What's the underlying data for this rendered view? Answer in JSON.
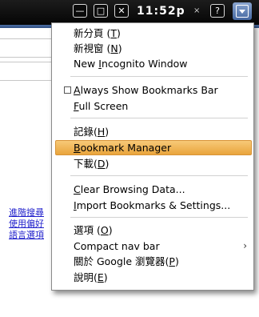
{
  "titlebar": {
    "minimize_glyph": "—",
    "maximize_glyph": "□",
    "close_glyph": "✕",
    "clock": "11:52p",
    "tab_close_glyph": "×",
    "help_glyph": "?"
  },
  "background": {
    "links": [
      "進階搜尋",
      "使用偏好",
      "語言選項"
    ]
  },
  "menu": {
    "items": {
      "new_tab": {
        "pre": "新分頁 (",
        "key": "T",
        "post": ")"
      },
      "new_window": {
        "pre": "新視窗 (",
        "key": "N",
        "post": ")"
      },
      "incognito": {
        "pre": "New ",
        "key": "I",
        "post": "ncognito Window"
      },
      "bookmarks_bar": {
        "pre": "",
        "key": "A",
        "post": "lways Show Bookmarks Bar"
      },
      "full_screen": {
        "pre": "",
        "key": "F",
        "post": "ull Screen"
      },
      "history": {
        "pre": "記錄(",
        "key": "H",
        "post": ")"
      },
      "bookmark_manager": {
        "pre": "",
        "key": "B",
        "post": "ookmark Manager"
      },
      "downloads": {
        "pre": "下載(",
        "key": "D",
        "post": ")"
      },
      "clear_data": {
        "pre": "",
        "key": "C",
        "post": "lear Browsing Data..."
      },
      "import": {
        "pre": "",
        "key": "I",
        "post": "mport Bookmarks & Settings..."
      },
      "options": {
        "pre": "選項 (",
        "key": "O",
        "post": ")"
      },
      "compact_nav": {
        "pre": "Compact nav bar",
        "key": "",
        "post": ""
      },
      "about": {
        "pre": "關於 Google 瀏覽器(",
        "key": "P",
        "post": ")"
      },
      "help": {
        "pre": "說明(",
        "key": "E",
        "post": ")"
      }
    },
    "submenu_arrow": "›"
  },
  "colors": {
    "highlight": "#f0b657",
    "link": "#2222cc",
    "topbar": "#101010"
  }
}
